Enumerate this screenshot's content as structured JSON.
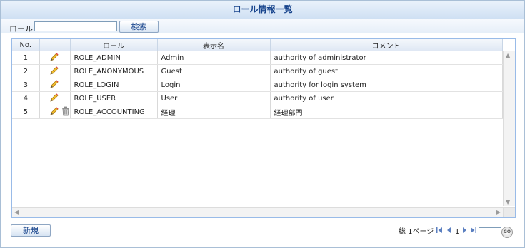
{
  "window": {
    "title": "ロール情報一覧"
  },
  "search": {
    "label": "ロール:",
    "value": "",
    "button": "検索"
  },
  "grid": {
    "columns": [
      "No.",
      "",
      "ロール",
      "表示名",
      "コメント"
    ],
    "rows": [
      {
        "no": "1",
        "role": "ROLE_ADMIN",
        "display_name": "Admin",
        "comment": "authority of administrator",
        "icons": [
          "edit-icon"
        ]
      },
      {
        "no": "2",
        "role": "ROLE_ANONYMOUS",
        "display_name": "Guest",
        "comment": "authority of guest",
        "icons": [
          "edit-icon"
        ]
      },
      {
        "no": "3",
        "role": "ROLE_LOGIN",
        "display_name": "Login",
        "comment": "authority for login system",
        "icons": [
          "edit-icon"
        ]
      },
      {
        "no": "4",
        "role": "ROLE_USER",
        "display_name": "User",
        "comment": "authority of user",
        "icons": [
          "edit-icon"
        ]
      },
      {
        "no": "5",
        "role": "ROLE_ACCOUNTING",
        "display_name": "経理",
        "comment": "経理部門",
        "icons": [
          "edit-icon",
          "trash-icon"
        ]
      }
    ]
  },
  "footer": {
    "new_button": "新規",
    "total_pages": "総 1ページ",
    "current_page": "1",
    "go_label": "GO"
  },
  "colors": {
    "header_text": "#15428b",
    "border": "#99bbe8",
    "pager_icon": "#5b7fc0"
  }
}
